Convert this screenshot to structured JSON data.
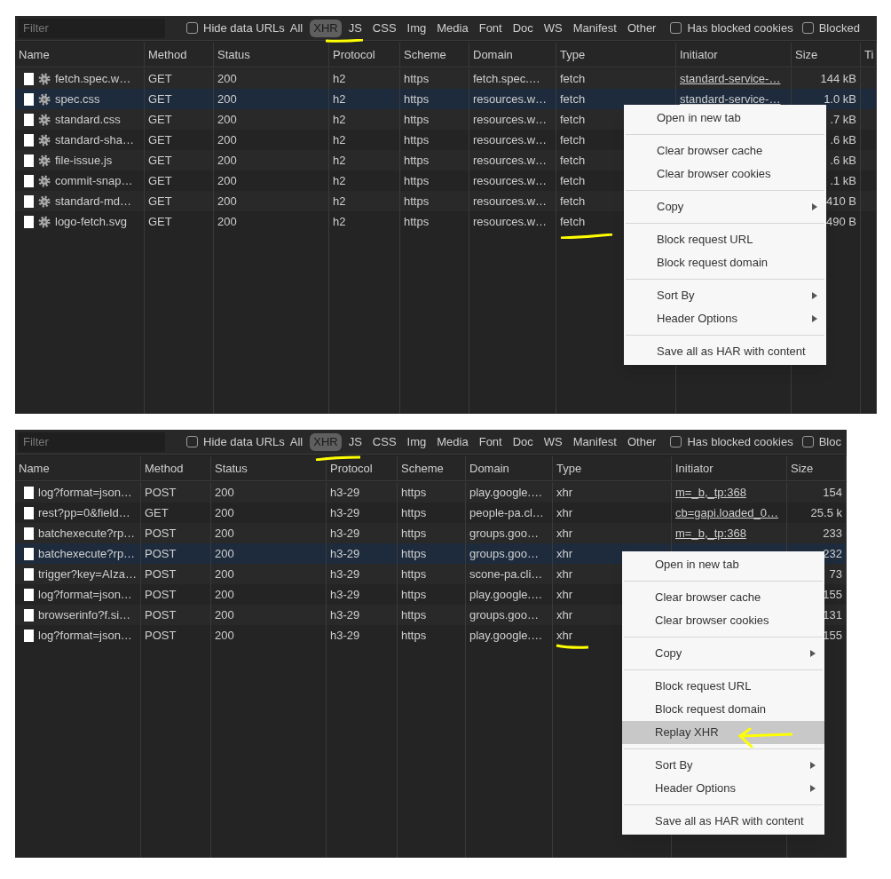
{
  "panels": [
    {
      "filter": {
        "placeholder": "Filter"
      },
      "filter_bar": [
        {
          "kind": "checkbox",
          "label": "Hide data URLs",
          "checked": false
        },
        {
          "kind": "type",
          "label": "All",
          "selected": false
        },
        {
          "kind": "type",
          "label": "XHR",
          "selected": true
        },
        {
          "kind": "type",
          "label": "JS",
          "selected": false
        },
        {
          "kind": "type",
          "label": "CSS",
          "selected": false
        },
        {
          "kind": "type",
          "label": "Img",
          "selected": false
        },
        {
          "kind": "type",
          "label": "Media",
          "selected": false
        },
        {
          "kind": "type",
          "label": "Font",
          "selected": false
        },
        {
          "kind": "type",
          "label": "Doc",
          "selected": false
        },
        {
          "kind": "type",
          "label": "WS",
          "selected": false
        },
        {
          "kind": "type",
          "label": "Manifest",
          "selected": false
        },
        {
          "kind": "type",
          "label": "Other",
          "selected": false
        },
        {
          "kind": "checkbox",
          "label": "Has blocked cookies",
          "checked": false
        },
        {
          "kind": "checkbox",
          "label": "Blocked",
          "checked": false
        }
      ],
      "columns": [
        "Name",
        "Method",
        "Status",
        "Protocol",
        "Scheme",
        "Domain",
        "Type",
        "Initiator",
        "Size",
        "Ti"
      ],
      "rows": [
        {
          "kind": "gear",
          "name": "fetch.spec.w…",
          "method": "GET",
          "status": "200",
          "protocol": "h2",
          "scheme": "https",
          "domain": "fetch.spec.…",
          "type": "fetch",
          "initiator": "standard-service-…",
          "size": "144 kB",
          "selected": false
        },
        {
          "kind": "gear",
          "name": "spec.css",
          "method": "GET",
          "status": "200",
          "protocol": "h2",
          "scheme": "https",
          "domain": "resources.w…",
          "type": "fetch",
          "initiator": "standard-service-…",
          "size": "1.0 kB",
          "selected": true
        },
        {
          "kind": "gear",
          "name": "standard.css",
          "method": "GET",
          "status": "200",
          "protocol": "h2",
          "scheme": "https",
          "domain": "resources.w…",
          "type": "fetch",
          "size": ".7 kB",
          "selected": false
        },
        {
          "kind": "gear",
          "name": "standard-sha…",
          "method": "GET",
          "status": "200",
          "protocol": "h2",
          "scheme": "https",
          "domain": "resources.w…",
          "type": "fetch",
          "size": ".6 kB",
          "selected": false
        },
        {
          "kind": "gear",
          "name": "file-issue.js",
          "method": "GET",
          "status": "200",
          "protocol": "h2",
          "scheme": "https",
          "domain": "resources.w…",
          "type": "fetch",
          "size": ".6 kB",
          "selected": false
        },
        {
          "kind": "gear",
          "name": "commit-snap…",
          "method": "GET",
          "status": "200",
          "protocol": "h2",
          "scheme": "https",
          "domain": "resources.w…",
          "type": "fetch",
          "size": ".1 kB",
          "selected": false
        },
        {
          "kind": "gear",
          "name": "standard-md…",
          "method": "GET",
          "status": "200",
          "protocol": "h2",
          "scheme": "https",
          "domain": "resources.w…",
          "type": "fetch",
          "size": "410 B",
          "selected": false
        },
        {
          "kind": "gear",
          "name": "logo-fetch.svg",
          "method": "GET",
          "status": "200",
          "protocol": "h2",
          "scheme": "https",
          "domain": "resources.w…",
          "type": "fetch",
          "size": "490 B",
          "selected": false
        }
      ],
      "context_menu": [
        [
          {
            "label": "Open in new tab",
            "submenu": false,
            "selected": false
          }
        ],
        [
          {
            "label": "Clear browser cache",
            "submenu": false,
            "selected": false
          },
          {
            "label": "Clear browser cookies",
            "submenu": false,
            "selected": false
          }
        ],
        [
          {
            "label": "Copy",
            "submenu": true,
            "selected": false
          }
        ],
        [
          {
            "label": "Block request URL",
            "submenu": false,
            "selected": false
          },
          {
            "label": "Block request domain",
            "submenu": false,
            "selected": false
          }
        ],
        [
          {
            "label": "Sort By",
            "submenu": true,
            "selected": false
          },
          {
            "label": "Header Options",
            "submenu": true,
            "selected": false
          }
        ],
        [
          {
            "label": "Save all as HAR with content",
            "submenu": false,
            "selected": false
          }
        ]
      ]
    },
    {
      "filter": {
        "placeholder": "Filter"
      },
      "filter_bar": [
        {
          "kind": "checkbox",
          "label": "Hide data URLs",
          "checked": false
        },
        {
          "kind": "type",
          "label": "All",
          "selected": false
        },
        {
          "kind": "type",
          "label": "XHR",
          "selected": true
        },
        {
          "kind": "type",
          "label": "JS",
          "selected": false
        },
        {
          "kind": "type",
          "label": "CSS",
          "selected": false
        },
        {
          "kind": "type",
          "label": "Img",
          "selected": false
        },
        {
          "kind": "type",
          "label": "Media",
          "selected": false
        },
        {
          "kind": "type",
          "label": "Font",
          "selected": false
        },
        {
          "kind": "type",
          "label": "Doc",
          "selected": false
        },
        {
          "kind": "type",
          "label": "WS",
          "selected": false
        },
        {
          "kind": "type",
          "label": "Manifest",
          "selected": false
        },
        {
          "kind": "type",
          "label": "Other",
          "selected": false
        },
        {
          "kind": "checkbox",
          "label": "Has blocked cookies",
          "checked": false
        },
        {
          "kind": "checkbox",
          "label": "Bloc",
          "checked": false
        }
      ],
      "columns": [
        "Name",
        "Method",
        "Status",
        "Protocol",
        "Scheme",
        "Domain",
        "Type",
        "Initiator",
        "Size"
      ],
      "rows": [
        {
          "kind": "plain",
          "name": "log?format=json…",
          "method": "POST",
          "status": "200",
          "protocol": "h3-29",
          "scheme": "https",
          "domain": "play.google.…",
          "type": "xhr",
          "initiator": "m=_b,_tp:368",
          "size": "154",
          "selected": false
        },
        {
          "kind": "plain",
          "name": "rest?pp=0&field…",
          "method": "GET",
          "status": "200",
          "protocol": "h3-29",
          "scheme": "https",
          "domain": "people-pa.cl…",
          "type": "xhr",
          "initiator": "cb=gapi.loaded_0…",
          "size": "25.5 k",
          "selected": false
        },
        {
          "kind": "plain",
          "name": "batchexecute?rp…",
          "method": "POST",
          "status": "200",
          "protocol": "h3-29",
          "scheme": "https",
          "domain": "groups.goo…",
          "type": "xhr",
          "initiator": "m=_b,_tp:368",
          "size": "233",
          "selected": false
        },
        {
          "kind": "plain",
          "name": "batchexecute?rp…",
          "method": "POST",
          "status": "200",
          "protocol": "h3-29",
          "scheme": "https",
          "domain": "groups.goo…",
          "type": "xhr",
          "size": "232",
          "selected": true
        },
        {
          "kind": "plain",
          "name": "trigger?key=AIza…",
          "method": "POST",
          "status": "200",
          "protocol": "h3-29",
          "scheme": "https",
          "domain": "scone-pa.cli…",
          "type": "xhr",
          "size": "73",
          "selected": false
        },
        {
          "kind": "plain",
          "name": "log?format=json…",
          "method": "POST",
          "status": "200",
          "protocol": "h3-29",
          "scheme": "https",
          "domain": "play.google.…",
          "type": "xhr",
          "size": "155",
          "selected": false
        },
        {
          "kind": "plain",
          "name": "browserinfo?f.si…",
          "method": "POST",
          "status": "200",
          "protocol": "h3-29",
          "scheme": "https",
          "domain": "groups.goo…",
          "type": "xhr",
          "size": "131",
          "selected": false
        },
        {
          "kind": "plain",
          "name": "log?format=json…",
          "method": "POST",
          "status": "200",
          "protocol": "h3-29",
          "scheme": "https",
          "domain": "play.google.…",
          "type": "xhr",
          "size": "155",
          "selected": false
        }
      ],
      "context_menu": [
        [
          {
            "label": "Open in new tab",
            "submenu": false,
            "selected": false
          }
        ],
        [
          {
            "label": "Clear browser cache",
            "submenu": false,
            "selected": false
          },
          {
            "label": "Clear browser cookies",
            "submenu": false,
            "selected": false
          }
        ],
        [
          {
            "label": "Copy",
            "submenu": true,
            "selected": false
          }
        ],
        [
          {
            "label": "Block request URL",
            "submenu": false,
            "selected": false
          },
          {
            "label": "Block request domain",
            "submenu": false,
            "selected": false
          },
          {
            "label": "Replay XHR",
            "submenu": false,
            "selected": true
          }
        ],
        [
          {
            "label": "Sort By",
            "submenu": true,
            "selected": false
          },
          {
            "label": "Header Options",
            "submenu": true,
            "selected": false
          }
        ],
        [
          {
            "label": "Save all as HAR with content",
            "submenu": false,
            "selected": false
          }
        ]
      ]
    }
  ]
}
